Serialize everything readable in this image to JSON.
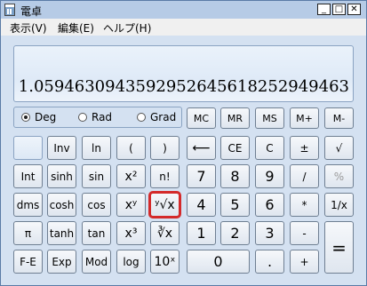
{
  "window": {
    "title": "電卓"
  },
  "window_buttons": {
    "minimize": "_",
    "maximize": "□",
    "close": "✕"
  },
  "menu": {
    "view": "表示(V)",
    "edit": "編集(E)",
    "help": "ヘルプ(H)"
  },
  "display": {
    "value": "1.0594630943592952645618252949463"
  },
  "angle_modes": {
    "deg": "Deg",
    "rad": "Rad",
    "grad": "Grad",
    "selected": "Deg"
  },
  "keys": {
    "mc": "MC",
    "mr": "MR",
    "ms": "MS",
    "mplus": "M+",
    "mminus": "M-",
    "inv": "Inv",
    "ln": "ln",
    "lparen": "(",
    "rparen": ")",
    "backspace": "⟵",
    "ce": "CE",
    "c": "C",
    "plusminus": "±",
    "sqrt": "√",
    "int": "Int",
    "sinh": "sinh",
    "sin": "sin",
    "x2": "x²",
    "fact": "n!",
    "7": "7",
    "8": "8",
    "9": "9",
    "divide": "/",
    "percent": "%",
    "dms": "dms",
    "cosh": "cosh",
    "cos": "cos",
    "xy": "xʸ",
    "yroot": "ʸ√x",
    "4": "4",
    "5": "5",
    "6": "6",
    "multiply": "*",
    "recip": "1/x",
    "pi": "π",
    "tanh": "tanh",
    "tan": "tan",
    "x3": "x³",
    "cuberoot": "∛x",
    "1": "1",
    "2": "2",
    "3": "3",
    "minus": "-",
    "equals": "=",
    "fe": "F-E",
    "exp": "Exp",
    "mod": "Mod",
    "log": "log",
    "pow10": "10ˣ",
    "0": "0",
    "dot": ".",
    "plus": "+"
  }
}
